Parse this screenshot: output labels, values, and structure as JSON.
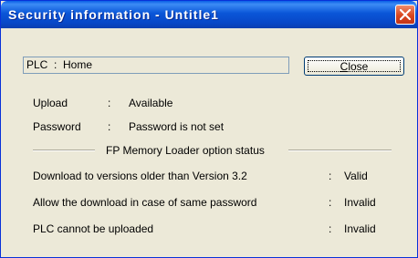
{
  "window": {
    "title": "Security information - Untitle1"
  },
  "plc": {
    "text": "PLC  :  Home"
  },
  "close_button": {
    "label_first": "C",
    "label_rest": "lose"
  },
  "info": {
    "upload_label": "Upload",
    "upload_sep": ":",
    "upload_value": "Available",
    "password_label": "Password",
    "password_sep": ":",
    "password_value": "Password is not set"
  },
  "option_status": {
    "group_title": "FP Memory Loader option status",
    "rows": [
      {
        "label": "Download to versions older than Version 3.2",
        "sep": ":",
        "value": "Valid"
      },
      {
        "label": "Allow the download in case of same password",
        "sep": ":",
        "value": "Invalid"
      },
      {
        "label": "PLC cannot be uploaded",
        "sep": ":",
        "value": "Invalid"
      }
    ]
  },
  "colors": {
    "titlebar": "#0a56d8",
    "dialog_bg": "#ece9d8",
    "close_icon_bg": "#d9461e"
  }
}
